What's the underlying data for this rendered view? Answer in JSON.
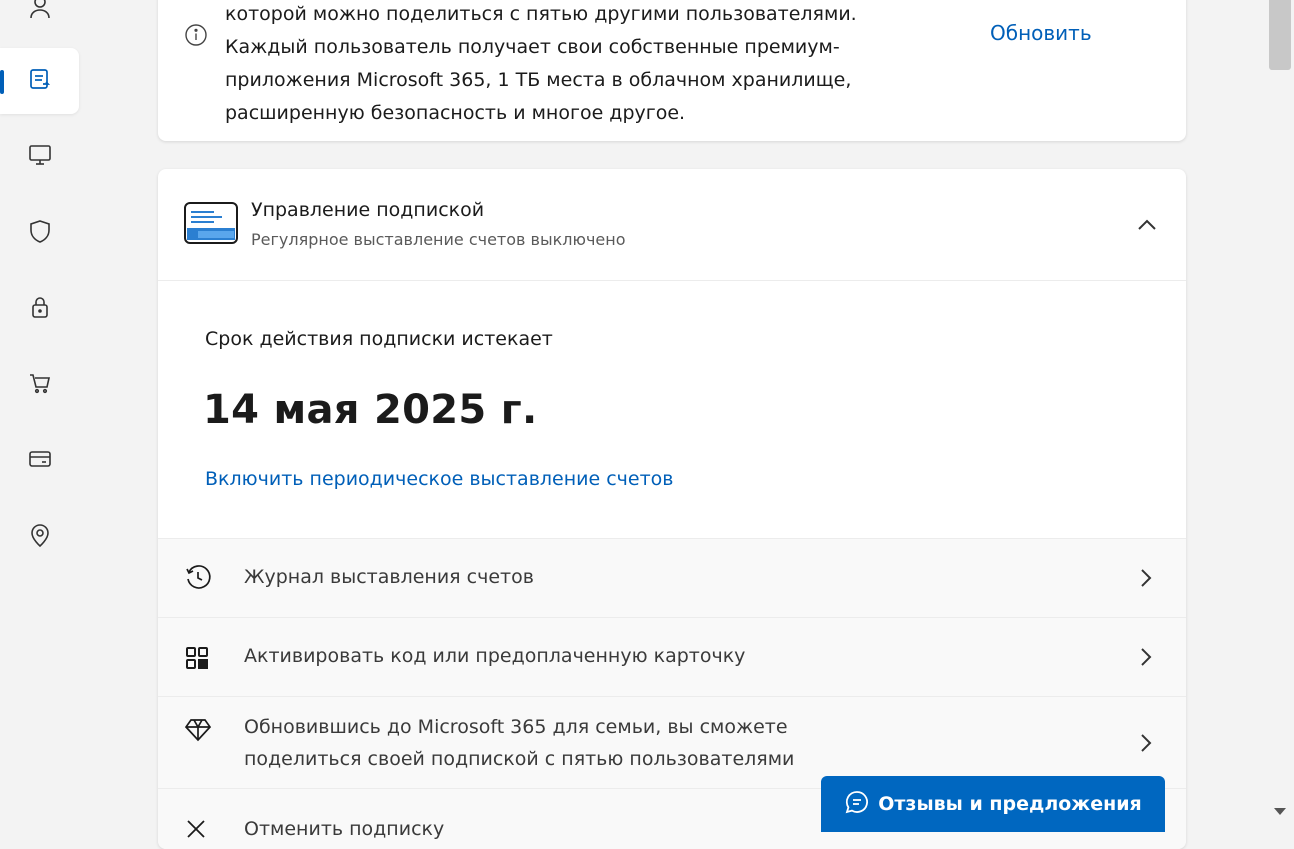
{
  "colors": {
    "accent": "#005fb8",
    "feedback_bg": "#0067c0"
  },
  "rail": {
    "items": [
      {
        "icon": "person-icon",
        "active": false
      },
      {
        "icon": "subscriptions-icon",
        "active": true
      },
      {
        "icon": "devices-icon",
        "active": false
      },
      {
        "icon": "shield-icon",
        "active": false
      },
      {
        "icon": "lock-icon",
        "active": false
      },
      {
        "icon": "cart-icon",
        "active": false
      },
      {
        "icon": "payment-card-icon",
        "active": false
      },
      {
        "icon": "location-icon",
        "active": false
      }
    ]
  },
  "info_card": {
    "text_line1": "которой можно поделиться с пятью другими пользователями.",
    "text_line2": "Каждый пользователь получает свои собственные премиум-",
    "text_line3": "приложения Microsoft 365, 1 ТБ места в облачном хранилище,",
    "text_line4": "расширенную безопасность и многое другое.",
    "update_link": "Обновить"
  },
  "subscription": {
    "title": "Управление подпиской",
    "subtitle": "Регулярное выставление счетов выключено",
    "expiry_label": "Срок действия подписки истекает",
    "expiry_date": "14 мая 2025 г.",
    "enable_link": "Включить периодическое выставление счетов",
    "rows": [
      {
        "icon": "history-icon",
        "line1": "Журнал выставления счетов",
        "line2": ""
      },
      {
        "icon": "qr-code-icon",
        "line1": "Активировать код или предоплаченную карточку",
        "line2": ""
      },
      {
        "icon": "diamond-icon",
        "line1": "Обновившись до Microsoft 365 для семьи, вы сможете",
        "line2": "поделиться своей подпиской с пятью пользователями"
      },
      {
        "icon": "close-icon",
        "line1": "Отменить подписку",
        "line2": ""
      }
    ]
  },
  "feedback_button": {
    "label": "Отзывы и предложения"
  }
}
